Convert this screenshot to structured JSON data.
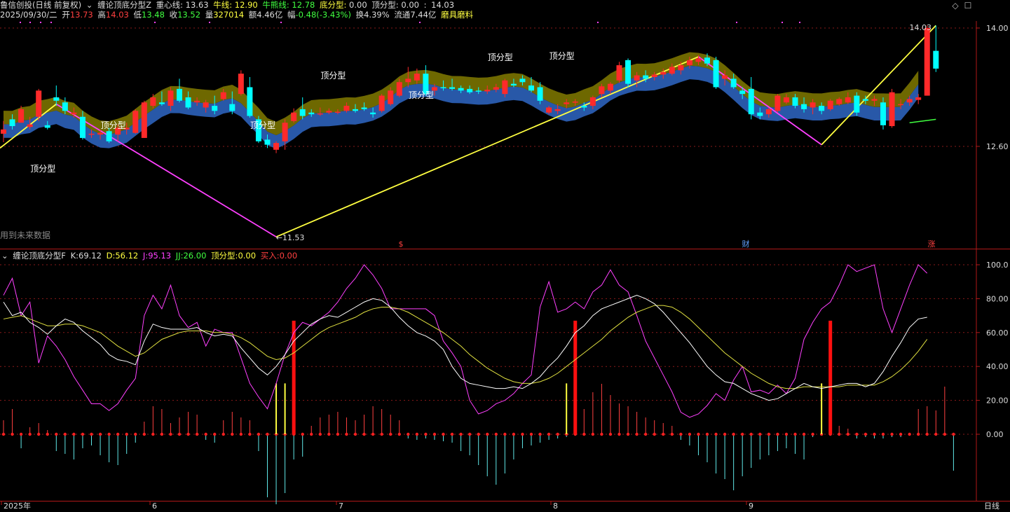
{
  "header": {
    "stock": "鲁信创投(日线 前复权)",
    "indicator": "缠论顶底分型Z",
    "zx_label": "重心线:",
    "zx_value": "13.63",
    "nx_label": "牛线:",
    "nx_value": "12.90",
    "nxl_label": "牛熊线:",
    "nxl_value": "12.78",
    "df_label": "底分型:",
    "df_value": "0.00",
    "dg_label": "顶分型:",
    "dg_value": "0.00",
    "sep": ":",
    "price_tag": "14.03"
  },
  "quote": {
    "date": "2025/09/30/二",
    "open_label": "开",
    "open": "13.73",
    "high_label": "高",
    "high": "14.03",
    "low_label": "低",
    "low": "13.48",
    "close_label": "收",
    "close": "13.52",
    "vol_label": "量",
    "vol": "327014",
    "amt_label": "额",
    "amt": "4.46亿",
    "chg_label": "幅",
    "chg": "-0.48(-3.43%)",
    "turn_label": "换",
    "turn": "4.39%",
    "float_label": "流通",
    "float": "7.44亿",
    "sector": "磨具磨料"
  },
  "main_chart": {
    "future_data_note": "用到未来数据",
    "high_label": "14.03",
    "low_label": "←11.53",
    "fractal_label": "顶分型",
    "markers": [
      "$",
      "财",
      "涨"
    ],
    "y_ticks": [
      "14.00",
      "12.60"
    ]
  },
  "sub_chart": {
    "title": "缠论顶底分型F",
    "k_label": "K:",
    "k": "69.12",
    "d_label": "D:",
    "d": "56.12",
    "j_label": "J:",
    "j": "95.13",
    "jj_label": "JJ:",
    "jj": "26.00",
    "dg_label": "顶分型:",
    "dg": "0.00",
    "buy_label": "买入:",
    "buy": "0.00",
    "y_ticks": [
      "100.0",
      "80.00",
      "60.00",
      "40.00",
      "20.00",
      "0.00"
    ]
  },
  "x_axis": {
    "labels": [
      "2025年",
      "6",
      "7",
      "8",
      "9"
    ],
    "period": "日线"
  },
  "colors": {
    "up": "#ff2a2a",
    "down": "#00ffff",
    "olive": "#6e6800",
    "blue": "#2858a8",
    "yellow": "#ffff40",
    "magenta": "#ff40ff",
    "grid": "#8a1a1a",
    "axis": "#b01818"
  },
  "candles": [
    [
      12.75,
      12.9,
      12.65,
      12.8
    ],
    [
      12.92,
      12.98,
      12.8,
      12.84
    ],
    [
      12.88,
      13.08,
      12.88,
      13.04
    ],
    [
      12.83,
      12.95,
      12.8,
      12.86
    ],
    [
      12.95,
      13.28,
      12.9,
      13.26
    ],
    [
      12.85,
      12.9,
      12.8,
      12.82
    ],
    [
      13.18,
      13.32,
      13.08,
      13.14
    ],
    [
      13.12,
      13.18,
      12.98,
      13.02
    ],
    [
      12.98,
      13.06,
      12.94,
      13.0
    ],
    [
      12.95,
      13.02,
      12.68,
      12.7
    ],
    [
      12.74,
      12.8,
      12.7,
      12.75
    ],
    [
      12.74,
      12.8,
      12.68,
      12.76
    ],
    [
      12.78,
      12.82,
      12.64,
      12.66
    ],
    [
      12.74,
      12.86,
      12.66,
      12.82
    ],
    [
      12.8,
      12.88,
      12.74,
      12.82
    ],
    [
      12.76,
      13.04,
      12.75,
      13.02
    ],
    [
      12.7,
      13.14,
      12.7,
      13.12
    ],
    [
      13.08,
      13.22,
      13.05,
      13.18
    ],
    [
      13.12,
      13.25,
      13.08,
      13.1
    ],
    [
      13.08,
      13.3,
      13.02,
      13.26
    ],
    [
      13.28,
      13.4,
      13.12,
      13.14
    ],
    [
      13.18,
      13.25,
      13.04,
      13.06
    ],
    [
      13.12,
      13.18,
      13.08,
      13.14
    ],
    [
      13.06,
      13.15,
      13.0,
      13.12
    ],
    [
      13.08,
      13.2,
      12.98,
      13.02
    ],
    [
      13.16,
      13.28,
      13.14,
      13.24
    ],
    [
      13.1,
      13.25,
      12.98,
      13.02
    ],
    [
      13.22,
      13.5,
      13.2,
      13.46
    ],
    [
      13.3,
      13.42,
      12.94,
      12.96
    ],
    [
      12.92,
      12.96,
      12.64,
      12.66
    ],
    [
      12.68,
      12.74,
      12.58,
      12.62
    ],
    [
      12.56,
      12.66,
      12.52,
      12.64
    ],
    [
      12.66,
      12.92,
      12.56,
      12.88
    ],
    [
      12.9,
      13.05,
      12.88,
      13.0
    ],
    [
      13.04,
      13.18,
      12.92,
      12.96
    ],
    [
      13.0,
      13.04,
      12.95,
      12.98
    ],
    [
      12.99,
      13.06,
      12.96,
      12.99
    ],
    [
      13.0,
      13.05,
      12.98,
      13.02
    ],
    [
      13.0,
      13.04,
      12.98,
      13.01
    ],
    [
      13.02,
      13.12,
      13.0,
      13.08
    ],
    [
      13.04,
      13.1,
      13.0,
      13.02
    ],
    [
      13.06,
      13.12,
      13.02,
      13.04
    ],
    [
      13.0,
      13.06,
      12.94,
      12.98
    ],
    [
      13.02,
      13.22,
      13.0,
      13.2
    ],
    [
      13.1,
      13.3,
      13.08,
      13.26
    ],
    [
      13.2,
      13.4,
      13.18,
      13.36
    ],
    [
      13.36,
      13.54,
      13.3,
      13.4
    ],
    [
      13.38,
      13.52,
      13.34,
      13.46
    ],
    [
      13.46,
      13.56,
      13.2,
      13.22
    ],
    [
      13.26,
      13.34,
      13.2,
      13.3
    ],
    [
      13.3,
      13.38,
      13.26,
      13.29
    ],
    [
      13.3,
      13.4,
      13.26,
      13.28
    ],
    [
      13.29,
      13.32,
      13.23,
      13.26
    ],
    [
      13.28,
      13.32,
      13.22,
      13.24
    ],
    [
      13.26,
      13.3,
      13.22,
      13.25
    ],
    [
      13.25,
      13.32,
      13.22,
      13.27
    ],
    [
      13.27,
      13.34,
      13.24,
      13.3
    ],
    [
      13.22,
      13.4,
      13.18,
      13.38
    ],
    [
      13.34,
      13.4,
      13.3,
      13.32
    ],
    [
      13.4,
      13.44,
      13.32,
      13.36
    ],
    [
      13.32,
      13.42,
      13.24,
      13.26
    ],
    [
      13.3,
      13.36,
      13.1,
      13.14
    ],
    [
      13.0,
      13.08,
      12.98,
      13.06
    ],
    [
      13.02,
      13.1,
      12.98,
      13.04
    ],
    [
      13.1,
      13.16,
      13.05,
      13.12
    ],
    [
      13.12,
      13.16,
      13.08,
      13.13
    ],
    [
      13.08,
      13.12,
      13.02,
      13.06
    ],
    [
      13.08,
      13.2,
      13.04,
      13.18
    ],
    [
      13.22,
      13.34,
      13.18,
      13.31
    ],
    [
      13.26,
      13.36,
      13.22,
      13.34
    ],
    [
      13.38,
      13.6,
      13.35,
      13.56
    ],
    [
      13.62,
      13.64,
      13.3,
      13.34
    ],
    [
      13.38,
      13.48,
      13.3,
      13.44
    ],
    [
      13.44,
      13.5,
      13.36,
      13.4
    ],
    [
      13.42,
      13.48,
      13.38,
      13.45
    ],
    [
      13.45,
      13.52,
      13.4,
      13.48
    ],
    [
      13.46,
      13.58,
      13.44,
      13.54
    ],
    [
      13.5,
      13.6,
      13.45,
      13.56
    ],
    [
      13.56,
      13.66,
      13.52,
      13.62
    ],
    [
      13.6,
      13.68,
      13.56,
      13.64
    ],
    [
      13.65,
      13.7,
      13.55,
      13.58
    ],
    [
      13.62,
      13.66,
      13.28,
      13.3
    ],
    [
      13.4,
      13.5,
      13.32,
      13.44
    ],
    [
      13.4,
      13.46,
      13.28,
      13.3
    ],
    [
      13.26,
      13.3,
      13.16,
      13.22
    ],
    [
      13.28,
      13.42,
      12.92,
      12.98
    ],
    [
      13.0,
      13.06,
      12.92,
      12.96
    ],
    [
      12.98,
      13.06,
      12.94,
      13.04
    ],
    [
      13.02,
      13.22,
      13.0,
      13.2
    ],
    [
      13.12,
      13.22,
      13.1,
      13.18
    ],
    [
      13.18,
      13.22,
      13.05,
      13.08
    ],
    [
      13.1,
      13.18,
      13.0,
      13.04
    ],
    [
      13.06,
      13.16,
      12.98,
      13.12
    ],
    [
      13.08,
      13.12,
      12.98,
      13.02
    ],
    [
      13.04,
      13.16,
      13.02,
      13.14
    ],
    [
      13.1,
      13.18,
      13.08,
      13.16
    ],
    [
      13.12,
      13.24,
      13.1,
      13.18
    ],
    [
      13.2,
      13.24,
      12.96,
      13.0
    ],
    [
      13.16,
      13.2,
      13.1,
      13.14
    ],
    [
      13.14,
      13.2,
      13.08,
      13.16
    ],
    [
      13.12,
      13.18,
      12.8,
      12.85
    ],
    [
      12.84,
      13.28,
      12.82,
      13.24
    ],
    [
      13.1,
      13.16,
      13.04,
      13.1
    ],
    [
      13.12,
      13.2,
      13.08,
      13.16
    ],
    [
      13.15,
      13.22,
      13.1,
      13.18
    ],
    [
      13.2,
      14.03,
      13.2,
      14.0
    ],
    [
      13.73,
      14.03,
      13.48,
      13.52
    ]
  ],
  "kdj": {
    "k": [
      78,
      70,
      72,
      66,
      63,
      59,
      64,
      68,
      66,
      61,
      57,
      53,
      47,
      44,
      43,
      41,
      55,
      65,
      63,
      62,
      62,
      62,
      63,
      60,
      58,
      59,
      58,
      51,
      45,
      39,
      35,
      40,
      47,
      55,
      60,
      65,
      68,
      70,
      69,
      72,
      75,
      78,
      80,
      79,
      75,
      69,
      64,
      60,
      58,
      55,
      50,
      40,
      33,
      30,
      29,
      28,
      27,
      27,
      28,
      27,
      30,
      34,
      40,
      45,
      52,
      60,
      64,
      70,
      74,
      76,
      78,
      80,
      82,
      80,
      77,
      72,
      66,
      60,
      54,
      47,
      40,
      35,
      31,
      30,
      27,
      24,
      22,
      20,
      21,
      24,
      27,
      30,
      28,
      27,
      28,
      29,
      30,
      30,
      28,
      30,
      37,
      46,
      54,
      63,
      68,
      69
    ],
    "d": [
      68,
      69,
      70,
      68,
      66,
      64,
      64,
      65,
      65,
      64,
      62,
      60,
      56,
      52,
      49,
      46,
      48,
      52,
      56,
      58,
      60,
      61,
      61,
      61,
      60,
      60,
      59,
      57,
      54,
      50,
      46,
      44,
      45,
      48,
      52,
      56,
      60,
      63,
      65,
      67,
      69,
      72,
      74,
      75,
      75,
      74,
      72,
      69,
      66,
      63,
      60,
      56,
      52,
      47,
      43,
      39,
      36,
      33,
      31,
      30,
      30,
      31,
      33,
      36,
      40,
      44,
      48,
      52,
      56,
      61,
      65,
      69,
      72,
      74,
      76,
      76,
      75,
      72,
      68,
      63,
      58,
      53,
      48,
      44,
      40,
      36,
      33,
      30,
      28,
      27,
      27,
      28,
      28,
      28,
      28,
      28,
      29,
      29,
      29,
      29,
      31,
      34,
      38,
      43,
      49,
      56
    ],
    "j": [
      82,
      92,
      70,
      78,
      42,
      58,
      52,
      44,
      34,
      26,
      18,
      18,
      14,
      18,
      26,
      33,
      70,
      82,
      74,
      88,
      70,
      63,
      66,
      52,
      62,
      60,
      60,
      45,
      30,
      22,
      15,
      30,
      47,
      60,
      66,
      64,
      68,
      72,
      78,
      86,
      92,
      100,
      94,
      86,
      74,
      74,
      74,
      74,
      74,
      70,
      55,
      48,
      40,
      20,
      12,
      14,
      18,
      20,
      24,
      30,
      35,
      75,
      90,
      72,
      74,
      78,
      74,
      84,
      88,
      97,
      88,
      84,
      70,
      55,
      45,
      35,
      25,
      13,
      10,
      12,
      17,
      24,
      20,
      32,
      40,
      25,
      26,
      24,
      29,
      24,
      33,
      56,
      66,
      74,
      78,
      88,
      100,
      96,
      98,
      100,
      74,
      60,
      74,
      88,
      100,
      95
    ],
    "bars": [
      10,
      18,
      -10,
      5,
      8,
      3,
      -12,
      -14,
      -18,
      -10,
      -8,
      -15,
      -20,
      -22,
      -14,
      -6,
      9,
      20,
      18,
      8,
      12,
      16,
      14,
      -4,
      -6,
      10,
      16,
      12,
      10,
      -12,
      -45,
      -50,
      -42,
      -18,
      -16,
      6,
      12,
      14,
      16,
      12,
      10,
      14,
      20,
      18,
      14,
      10,
      -3,
      -4,
      -3,
      -4,
      -5,
      -6,
      -12,
      -15,
      -22,
      -30,
      -36,
      -28,
      -18,
      -10,
      -8,
      -6,
      -4,
      -3,
      -2,
      5,
      18,
      30,
      36,
      28,
      22,
      20,
      16,
      12,
      10,
      8,
      6,
      -4,
      -8,
      -15,
      -20,
      -28,
      -32,
      -40,
      -30,
      -24,
      -18,
      -15,
      -12,
      -10,
      -14,
      -18,
      -2,
      -1,
      3,
      6,
      4,
      -3,
      -2,
      -3,
      -3,
      -2,
      -2,
      -1,
      18,
      20,
      17,
      34,
      -26
    ],
    "yellow_spikes": [
      31,
      32,
      64,
      93
    ],
    "red_spikes": [
      33,
      65,
      94
    ]
  }
}
